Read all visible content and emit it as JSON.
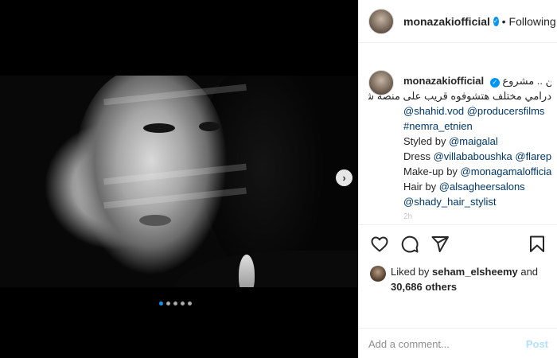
{
  "post": {
    "username": "monazakiofficial",
    "separator": "•",
    "follow_status": "Following",
    "verified_icon": "check-icon"
  },
  "caption": {
    "username": "monazakiofficial",
    "arabic_line1": "نمرة اتنين .. مشروع",
    "arabic_line2": "درامي مختلف هتشوفوه قريب على منصة شاهد",
    "tags_line": "@shahid.vod @producersfilms",
    "hashtag": "#nemra_etnien",
    "styled_prefix": "Styled by ",
    "styled_by": "@maigalal",
    "dress_prefix": "Dress ",
    "dress_tags": "@villababoushka @flarepr",
    "makeup_prefix": "Make-up by ",
    "makeup_by": "@monagamalofficial",
    "hair_prefix": "Hair by ",
    "hair_by": "@alsagheersalons",
    "stylist": "@shady_hair_stylist",
    "time_fragment": "2h"
  },
  "likes": {
    "prefix": "Liked by ",
    "user": "seham_elsheemy",
    "and": " and",
    "others": "30,686 others"
  },
  "comment": {
    "placeholder": "Add a comment...",
    "post_label": "Post"
  },
  "carousel": {
    "total": 5,
    "active_index": 0
  },
  "colors": {
    "accent": "#0095f6",
    "link": "#00376b",
    "post_disabled": "#b2dffc"
  }
}
